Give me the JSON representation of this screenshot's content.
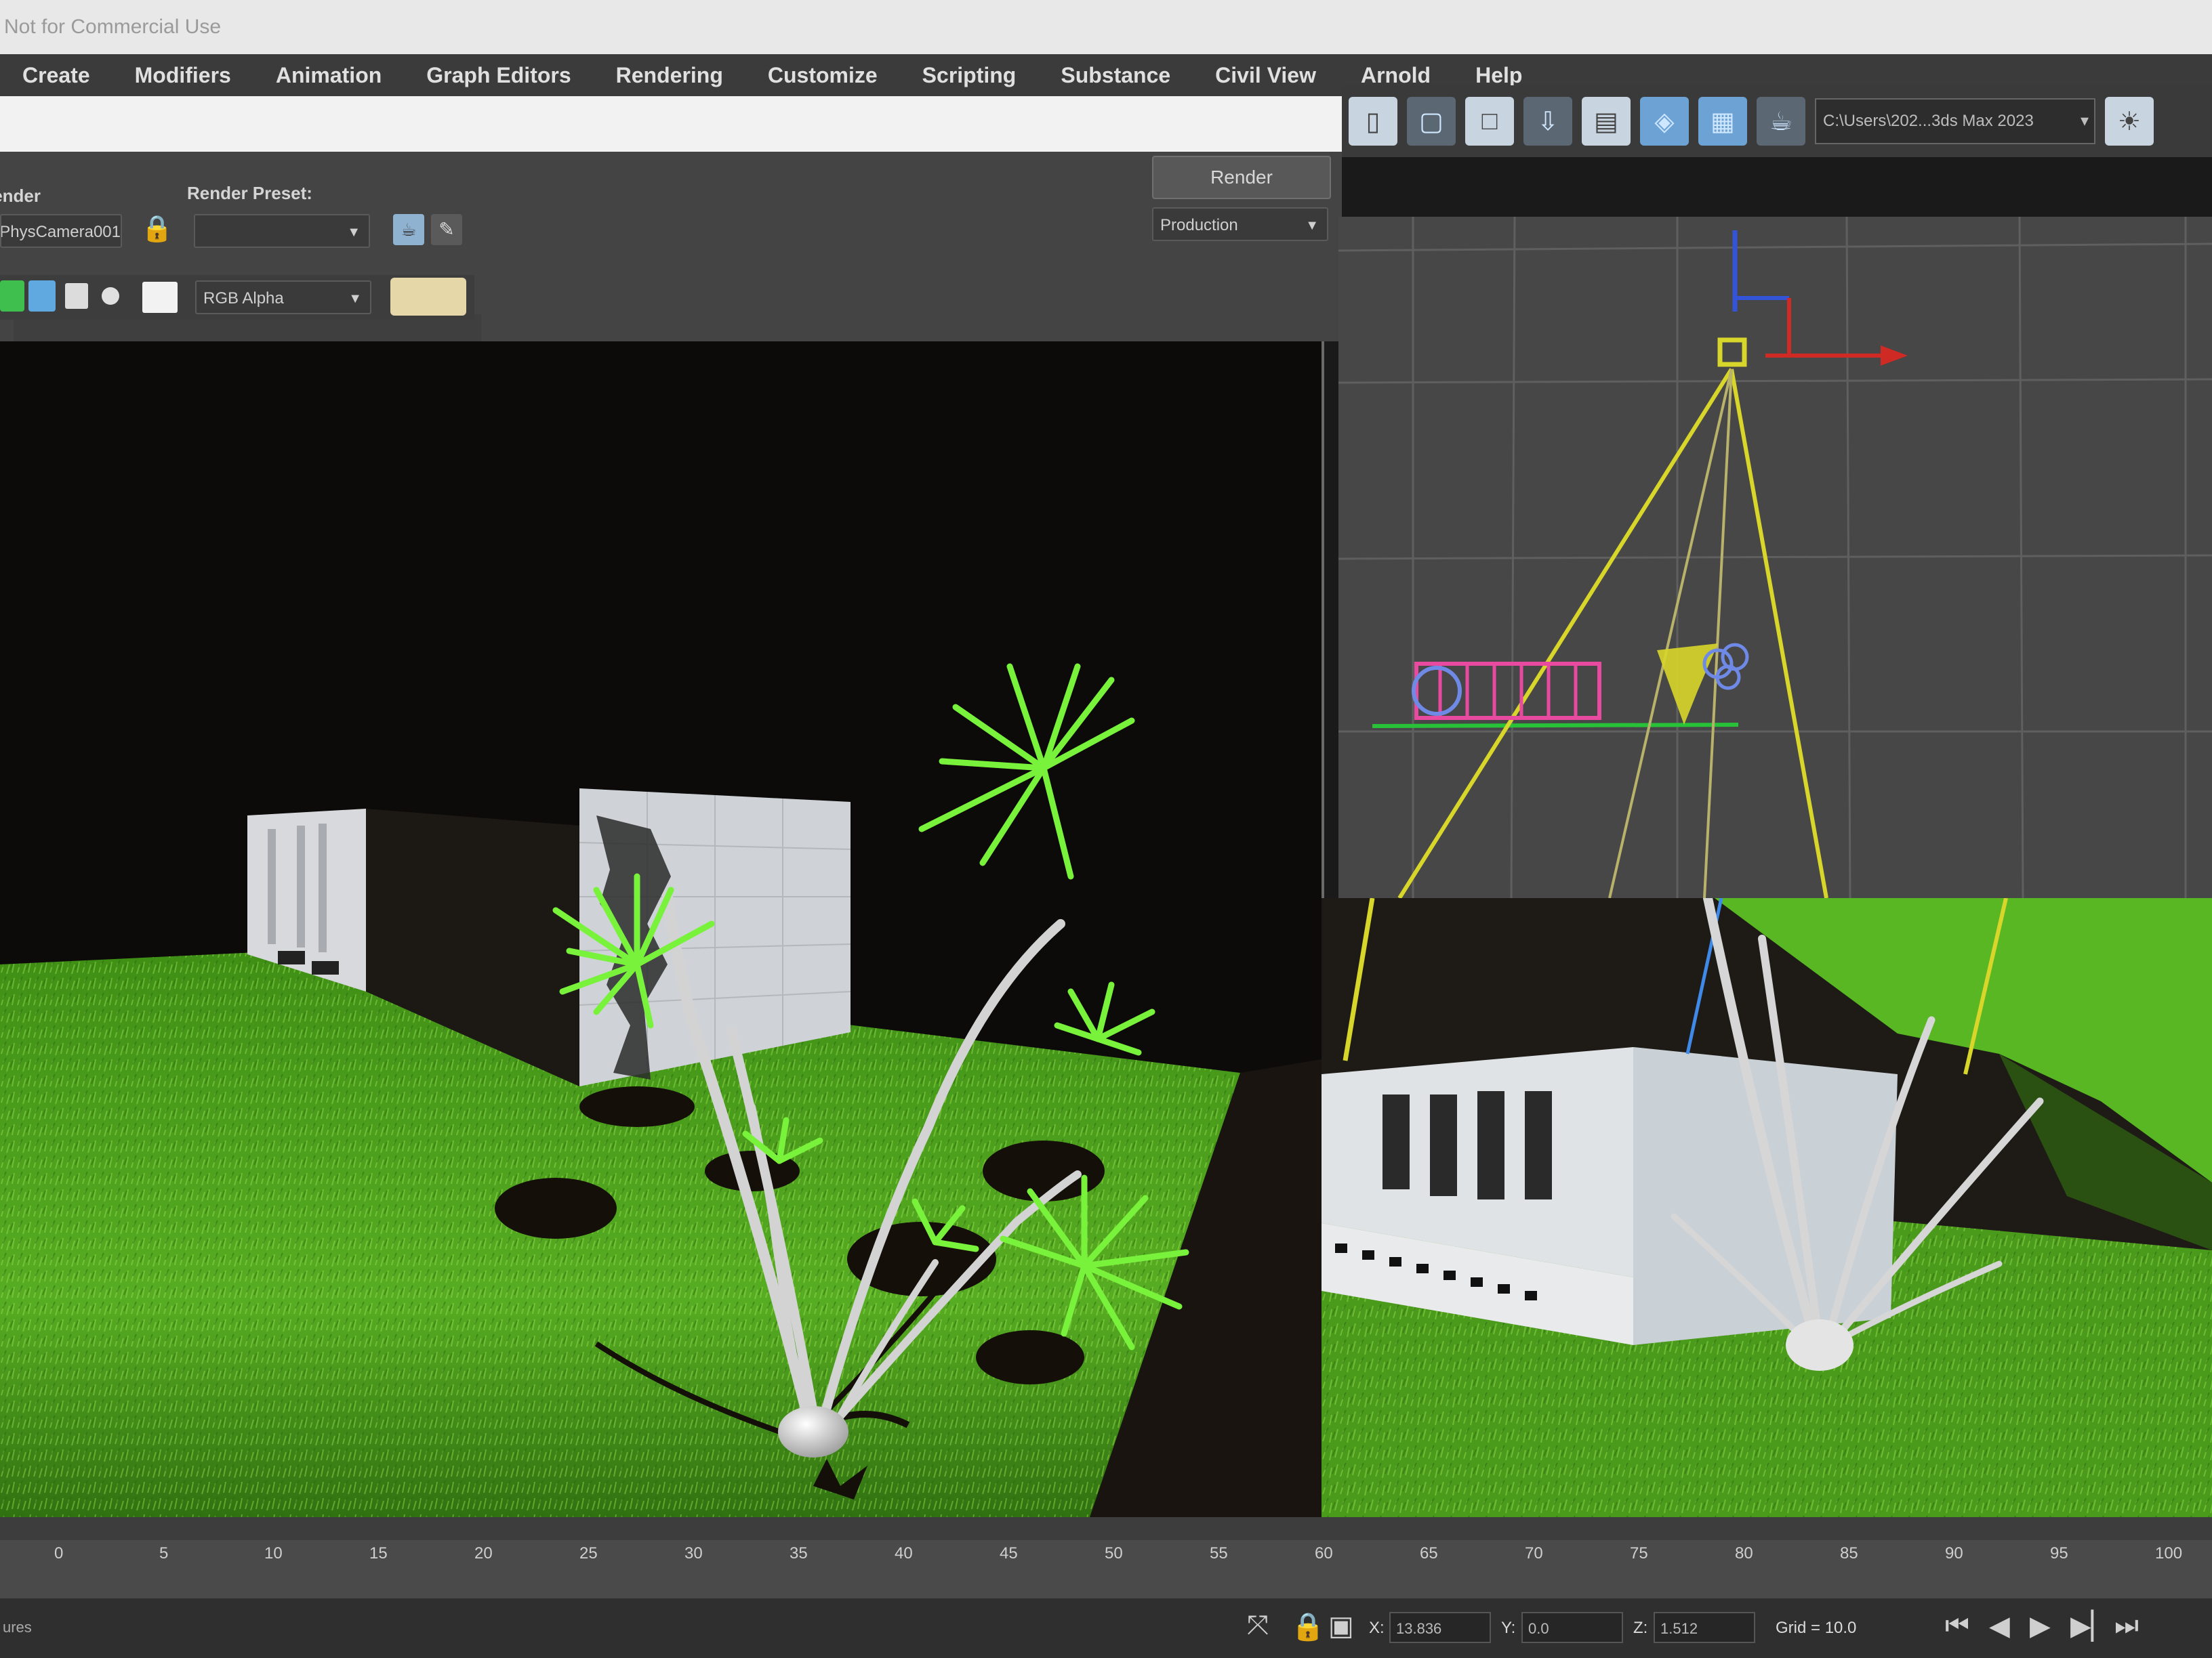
{
  "window": {
    "title": "Not for Commercial Use"
  },
  "menu": {
    "items": [
      "Create",
      "Modifiers",
      "Animation",
      "Graph Editors",
      "Rendering",
      "Customize",
      "Scripting",
      "Substance",
      "Civil View",
      "Arnold",
      "Help"
    ]
  },
  "toolbar": {
    "path": "C:\\Users\\202...3ds Max 2023",
    "path_arrow": "▾"
  },
  "render_frame": {
    "area_label": "Area to Render:",
    "camera_value": "PhysCamera001",
    "render_preset_label": "Render Preset:",
    "render_preset_value": "",
    "render_button": "Render",
    "production_value": "Production",
    "channel_value": "RGB Alpha"
  },
  "icons": {
    "lock": "lock-icon",
    "teapot": "teapot-icon",
    "pencil": "pencil-icon",
    "dropdown": "chevron-down-icon"
  },
  "timeline": {
    "ticks": [
      "0",
      "5",
      "10",
      "15",
      "20",
      "25",
      "30",
      "35",
      "40",
      "45",
      "50",
      "55",
      "60",
      "65",
      "70",
      "75",
      "80",
      "85",
      "90",
      "95",
      "100"
    ]
  },
  "status": {
    "x_label": "X:",
    "x_value": "13.836",
    "y_label": "Y:",
    "y_value": "0.0",
    "z_label": "Z:",
    "z_value": "1.512",
    "grid_label": "Grid = 10.0",
    "left_text": "ures"
  },
  "colors": {
    "grass": "#4f9f1f",
    "leaf": "#73f03a",
    "trunk": "#d8d8d8",
    "gizmo_yellow": "#d8d62a",
    "axis_red": "#d02a24",
    "axis_blue": "#3454d8",
    "highlight_blue": "#6da3d4"
  }
}
